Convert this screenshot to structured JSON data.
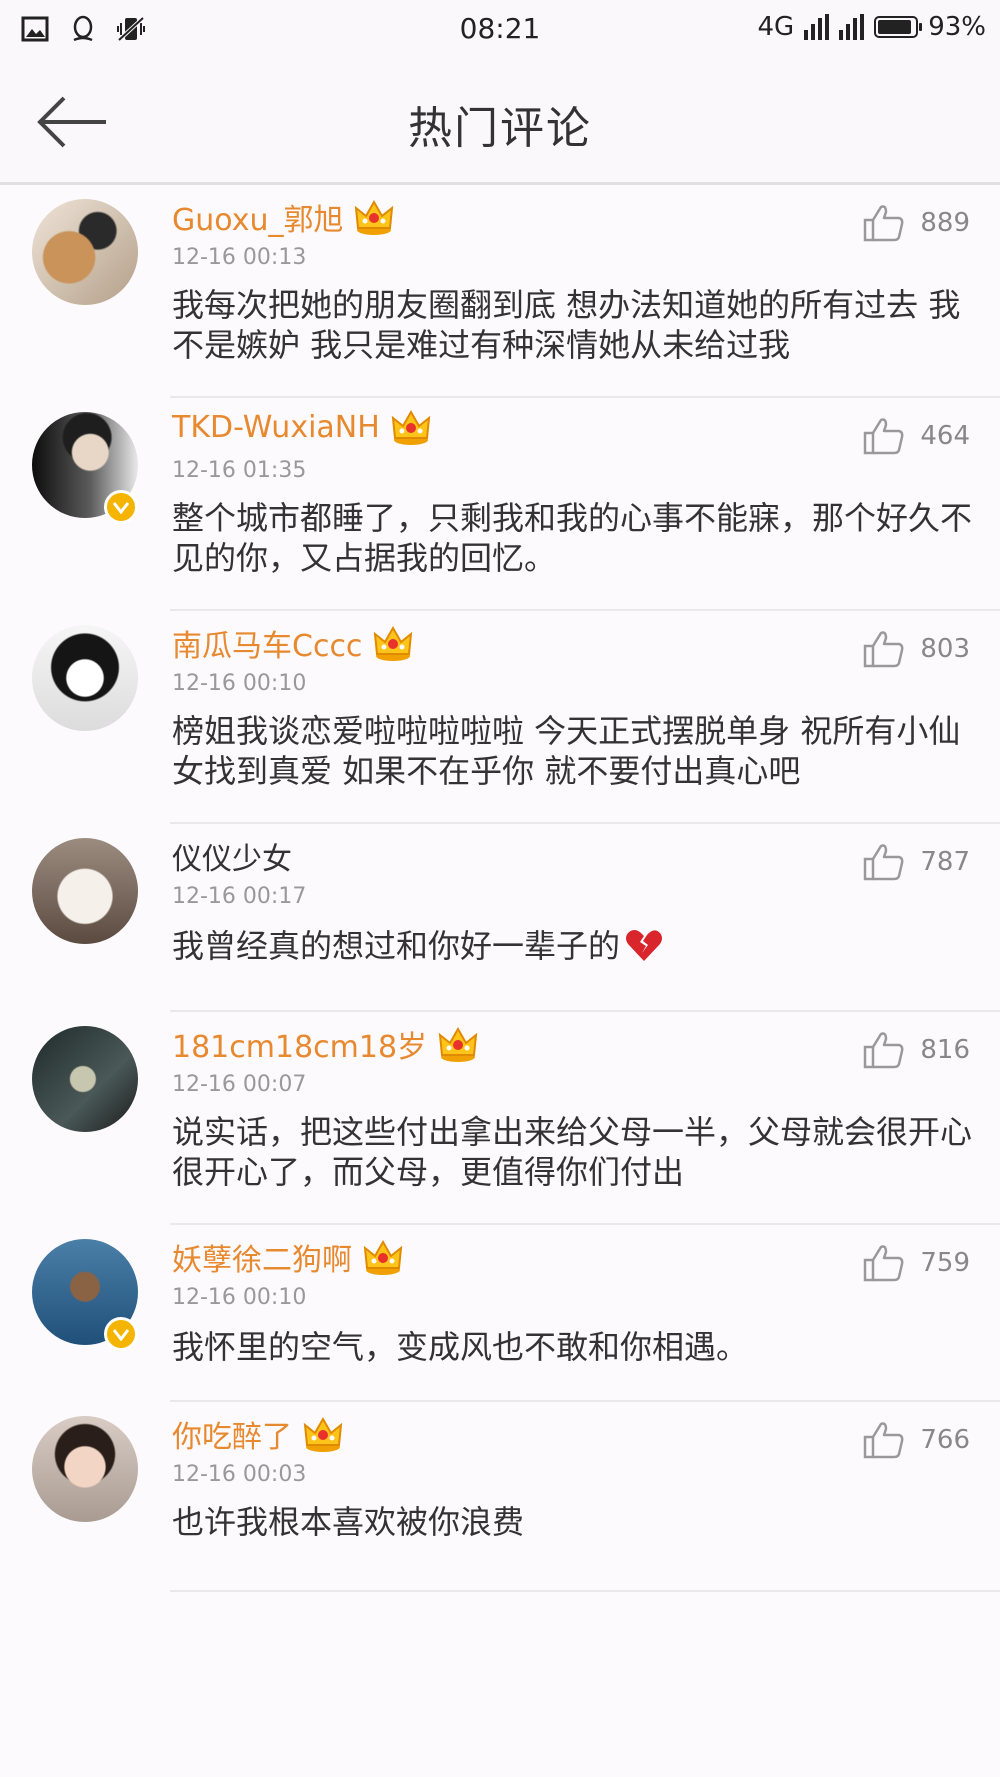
{
  "status_bar": {
    "time": "08:21",
    "network": "4G",
    "battery_percent": "93%",
    "battery_level": 0.93,
    "left_icons": [
      "image-icon",
      "qq-icon",
      "vibrate-mute-icon"
    ]
  },
  "header": {
    "title": "热门评论",
    "back_icon": "back-arrow-icon"
  },
  "colors": {
    "username": "#e7892f",
    "crown": "#f5b400",
    "verified": "#f5b400",
    "text": "#333333",
    "meta": "#999999"
  },
  "comments": [
    {
      "username": "Guoxu_郭旭",
      "crown": true,
      "verified": false,
      "time": "12-16 00:13",
      "text": "我每次把她的朋友圈翻到底 想办法知道她的所有过去 我不是嫉妒 我只是难过有种深情她从未给过我",
      "likes": "889"
    },
    {
      "username": "TKD-WuxiaNH",
      "crown": true,
      "verified": true,
      "time": "12-16 01:35",
      "text": "整个城市都睡了，只剩我和我的心事不能寐，那个好久不见的你，又占据我的回忆。",
      "likes": "464"
    },
    {
      "username": "南瓜马车Cccc",
      "crown": true,
      "verified": false,
      "time": "12-16 00:10",
      "text": "榜姐我谈恋爱啦啦啦啦啦 今天正式摆脱单身 祝所有小仙女找到真爱  如果不在乎你 就不要付出真心吧",
      "likes": "803"
    },
    {
      "username": "仪仪少女",
      "crown": false,
      "verified": false,
      "time": "12-16 00:17",
      "text": "我曾经真的想过和你好一辈子的",
      "emoji": "broken-heart-icon",
      "likes": "787"
    },
    {
      "username": "181cm18cm18岁",
      "crown": true,
      "verified": false,
      "time": "12-16 00:07",
      "text": "说实话，把这些付出拿出来给父母一半，父母就会很开心很开心了，而父母，更值得你们付出",
      "likes": "816"
    },
    {
      "username": "妖孽徐二狗啊",
      "crown": true,
      "verified": true,
      "time": "12-16 00:10",
      "text": "我怀里的空气，变成风也不敢和你相遇。",
      "likes": "759"
    },
    {
      "username": "你吃醉了",
      "crown": true,
      "verified": false,
      "time": "12-16 00:03",
      "text": "也许我根本喜欢被你浪费",
      "likes": "766"
    }
  ]
}
